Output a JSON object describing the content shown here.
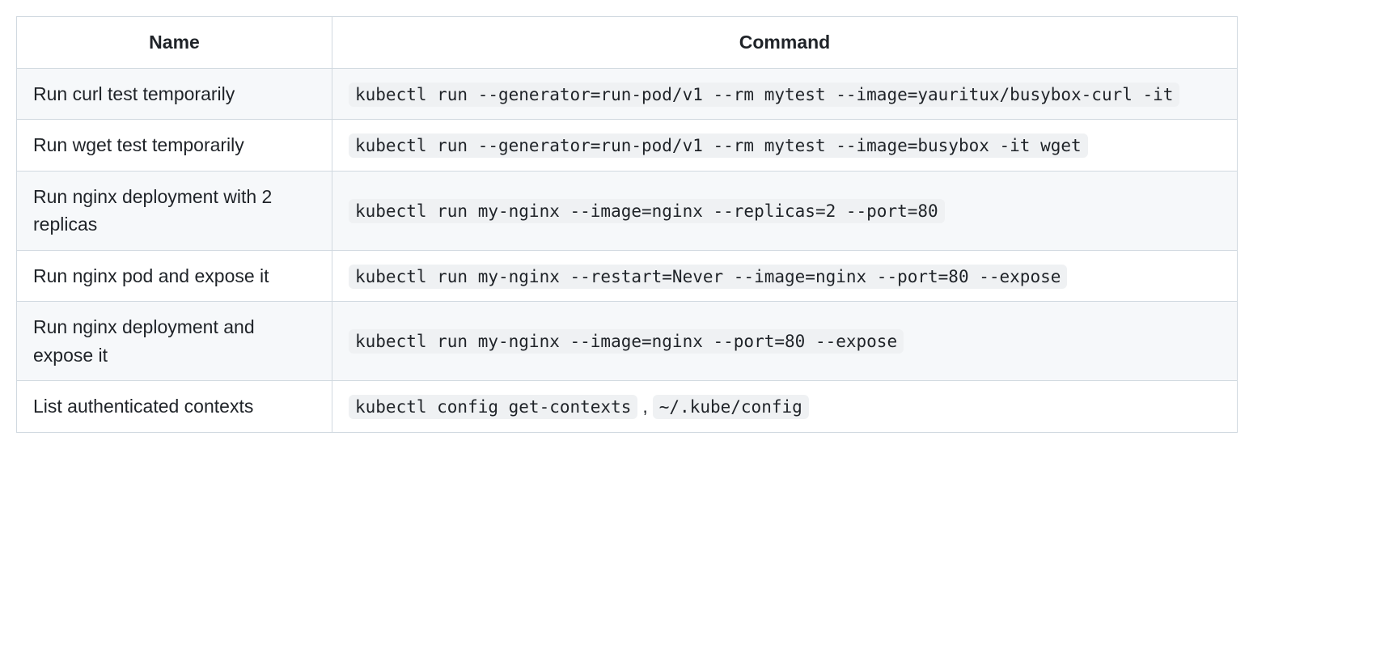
{
  "table": {
    "headers": {
      "name": "Name",
      "command": "Command"
    },
    "rows": [
      {
        "name": "Run curl test temporarily",
        "commands": [
          "kubectl run --generator=run-pod/v1 --rm mytest --image=yauritux/busybox-curl -it"
        ]
      },
      {
        "name": "Run wget test temporarily",
        "commands": [
          "kubectl run --generator=run-pod/v1 --rm mytest --image=busybox -it wget"
        ]
      },
      {
        "name": "Run nginx deployment with 2 replicas",
        "commands": [
          "kubectl run my-nginx --image=nginx --replicas=2 --port=80"
        ]
      },
      {
        "name": "Run nginx pod and expose it",
        "commands": [
          "kubectl run my-nginx --restart=Never --image=nginx --port=80 --expose"
        ]
      },
      {
        "name": "Run nginx deployment and expose it",
        "commands": [
          "kubectl run my-nginx --image=nginx --port=80 --expose"
        ]
      },
      {
        "name": "List authenticated contexts",
        "commands": [
          "kubectl config get-contexts",
          "~/.kube/config"
        ]
      }
    ]
  }
}
